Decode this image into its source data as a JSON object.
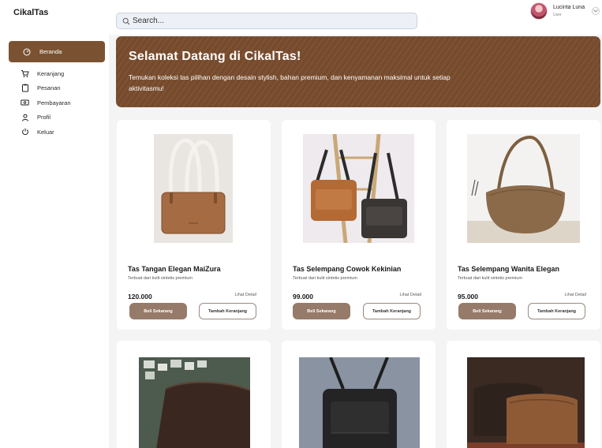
{
  "app": {
    "brand": "CikalTas"
  },
  "search": {
    "placeholder": "Search..."
  },
  "user": {
    "name": "Lucinta Luna",
    "role": "User"
  },
  "sidebar": {
    "items": [
      {
        "label": "Beranda",
        "icon": "dashboard-icon",
        "active": true
      },
      {
        "label": "Keranjang",
        "icon": "cart-icon",
        "active": false
      },
      {
        "label": "Pesanan",
        "icon": "clipboard-icon",
        "active": false
      },
      {
        "label": "Pembayaran",
        "icon": "money-icon",
        "active": false
      },
      {
        "label": "Profil",
        "icon": "user-icon",
        "active": false
      },
      {
        "label": "Keluar",
        "icon": "power-icon",
        "active": false
      }
    ]
  },
  "hero": {
    "title": "Selamat Datang di CikalTas!",
    "text": "Temukan koleksi tas pilihan dengan desain stylish, bahan premium, dan kenyamanan maksimal untuk setiap aktivitasmu!"
  },
  "products": [
    {
      "title": "Tas Tangan Elegan MaiZura",
      "desc": "Terbuat dari kulit sintetis premium",
      "price": "120.000",
      "detail": "Lihat Detail",
      "buy": "Beli Sekarang",
      "cart": "Tambah Keranjang"
    },
    {
      "title": "Tas Selempang Cowok Kekinian",
      "desc": "Terbuat dari kulit sintetis premium",
      "price": "99.000",
      "detail": "Lihat Detail",
      "buy": "Beli Sekarang",
      "cart": "Tambah Keranjang"
    },
    {
      "title": "Tas Selempang Wanita Elegan",
      "desc": "Terbuat dari kulit sintetis premium",
      "price": "95.000",
      "detail": "Lihat Detail",
      "buy": "Beli Sekarang",
      "cart": "Tambah Keranjang"
    }
  ],
  "colors": {
    "accent": "#7a5232",
    "hero": "#7a4d2e",
    "buy_button": "#967b6a"
  }
}
